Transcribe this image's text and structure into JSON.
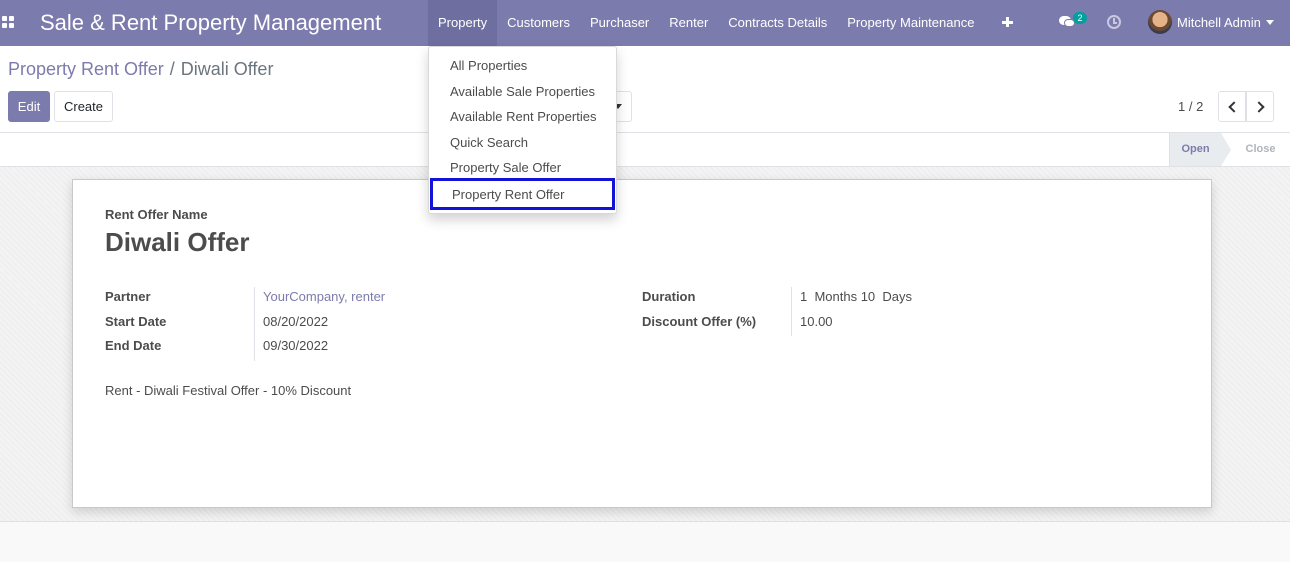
{
  "navbar": {
    "app_title": "Sale & Rent Property Management",
    "menu": [
      "Property",
      "Customers",
      "Purchaser",
      "Renter",
      "Contracts Details",
      "Property Maintenance"
    ],
    "active_menu": "Property",
    "chat_count": "2",
    "user_name": "Mitchell Admin",
    "icons": [
      "apps-grid-icon",
      "plus-icon",
      "chat-icon",
      "clock-icon",
      "avatar",
      "caret-down-icon"
    ],
    "color": "#7c7bad"
  },
  "property_menu": {
    "items": [
      "All Properties",
      "Available Sale Properties",
      "Available Rent Properties",
      "Quick Search",
      "Property Sale Offer",
      "Property Rent Offer"
    ],
    "highlighted": "Property Rent Offer",
    "highlight_color": "#1212d8"
  },
  "control_panel": {
    "breadcrumb_parent": "Property Rent Offer",
    "breadcrumb_separator": "/",
    "breadcrumb_current": "Diwali Offer",
    "edit_label": "Edit",
    "create_label": "Create",
    "pager": "1 / 2"
  },
  "statusbar": {
    "stages": [
      "Open",
      "Close"
    ],
    "current": "Open"
  },
  "form": {
    "name_label": "Rent Offer Name",
    "name": "Diwali Offer",
    "partner_label": "Partner",
    "partner": "YourCompany, renter",
    "start_date_label": "Start Date",
    "start_date": "08/20/2022",
    "end_date_label": "End Date",
    "end_date": "09/30/2022",
    "duration_label": "Duration",
    "duration": "1  Months 10  Days",
    "discount_label": "Discount Offer (%)",
    "discount": "10.00",
    "description": "Rent - Diwali Festival Offer - 10% Discount"
  }
}
